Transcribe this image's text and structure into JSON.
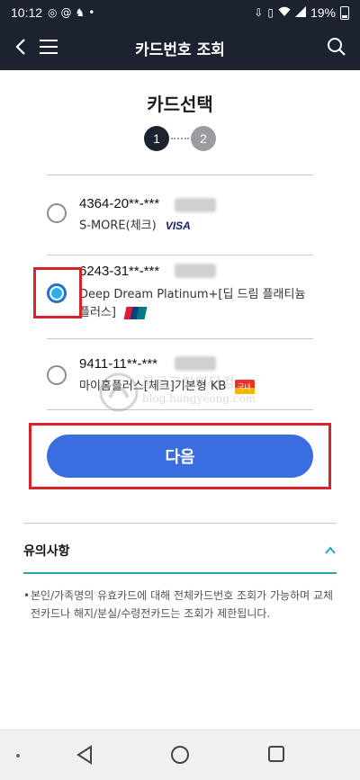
{
  "status_bar": {
    "time": "10:12",
    "battery": "19%"
  },
  "header": {
    "title": "카드번호 조회"
  },
  "section_title": "카드선택",
  "steps": [
    "1",
    "2"
  ],
  "cards": [
    {
      "number": "4364-20**-***",
      "name": "S-MORE(체크)",
      "brand": "VISA",
      "selected": false
    },
    {
      "number": "6243-31**-***",
      "name": "Deep Dream Platinum+[딥 드림 플래티늄 플러스]",
      "brand": "UnionPay",
      "selected": true
    },
    {
      "number": "9411-11**-***",
      "name": "마이홈플러스[체크]기본형 KB",
      "brand": "국내",
      "selected": false
    }
  ],
  "watermark": {
    "title": "블로그한영닷컴",
    "url": "blog.hangyeong.com"
  },
  "next_button": "다음",
  "notice": {
    "title": "유의사항",
    "bullet": "•",
    "text": "본인/가족명의 유효카드에 대해 전체카드번호 조회가 가능하며 교체전카드나 해지/분실/수령전카드는 조회가 제한됩니다."
  },
  "colors": {
    "header_bg": "#1c2230",
    "accent": "#3a6ee0",
    "highlight": "#d8232a",
    "notice_line": "#2aa5b3"
  }
}
